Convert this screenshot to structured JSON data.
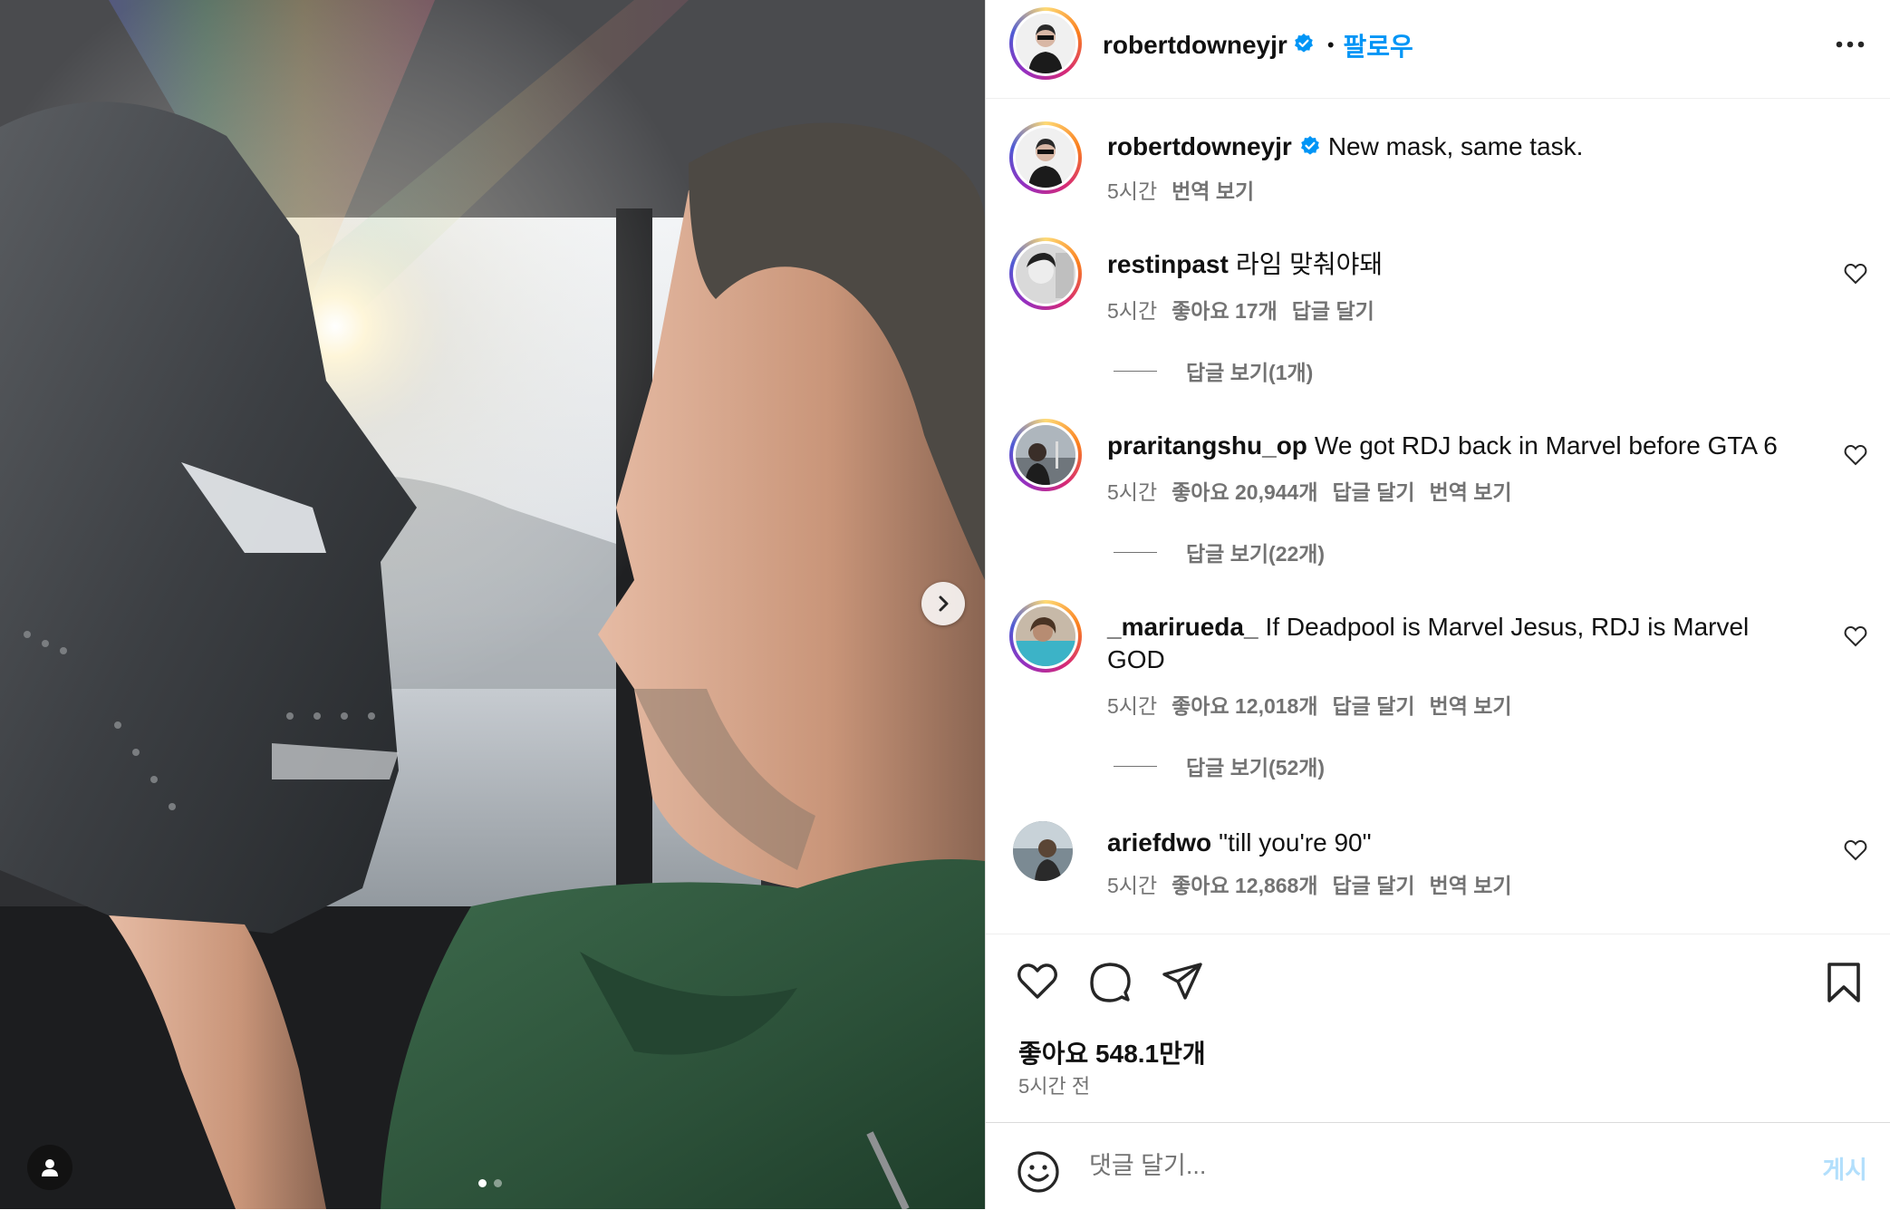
{
  "post": {
    "author": "robertdowneyjr",
    "follow_label": "팔로우",
    "caption": "New mask, same task.",
    "caption_time": "5시간",
    "caption_translate": "번역 보기",
    "carousel": {
      "total": 2,
      "current": 1
    }
  },
  "comments": [
    {
      "user": "restinpast",
      "text": "라임 맞춰야돼",
      "time": "5시간",
      "likes": "좋아요 17개",
      "reply": "답글 달기",
      "translate": "",
      "view_replies": "답글 보기(1개)"
    },
    {
      "user": "praritangshu_op",
      "text": "We got RDJ back in Marvel before GTA 6",
      "time": "5시간",
      "likes": "좋아요 20,944개",
      "reply": "답글 달기",
      "translate": "번역 보기",
      "view_replies": "답글 보기(22개)"
    },
    {
      "user": "_marirueda_",
      "text": "If Deadpool is Marvel Jesus, RDJ is Marvel GOD",
      "time": "5시간",
      "likes": "좋아요 12,018개",
      "reply": "답글 달기",
      "translate": "번역 보기",
      "view_replies": "답글 보기(52개)"
    },
    {
      "user": "ariefdwo",
      "text": "\"till you're 90\"",
      "time": "5시간",
      "likes": "좋아요 12,868개",
      "reply": "답글 달기",
      "translate": "번역 보기",
      "view_replies": ""
    }
  ],
  "footer": {
    "likes": "좋아요 548.1만개",
    "posted": "5시간 전",
    "comment_placeholder": "댓글 달기...",
    "post_label": "게시"
  },
  "icons": {
    "verified": "verified-badge-icon",
    "more": "more-options-icon",
    "heart": "heart-icon",
    "comment": "comment-icon",
    "share": "share-icon",
    "save": "bookmark-icon",
    "emoji": "emoji-icon",
    "next": "chevron-right-icon",
    "user_tag": "person-icon"
  },
  "colors": {
    "accent": "#0095f6",
    "verified": "#0095f6",
    "muted": "#737373"
  }
}
